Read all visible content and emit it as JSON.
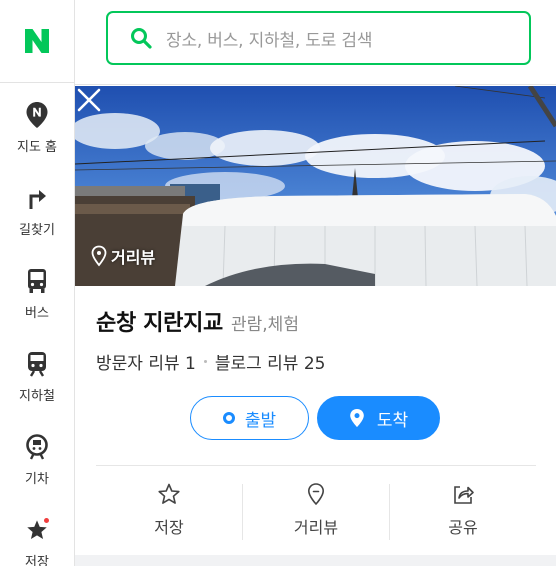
{
  "app": {
    "logo_text": "N",
    "brand_color": "#03c75a",
    "accent_color": "#1a8cff"
  },
  "search": {
    "placeholder": "장소, 버스, 지하철, 도로 검색"
  },
  "sidebar": {
    "items": [
      {
        "label": "지도 홈",
        "icon": "map-pin-n-icon"
      },
      {
        "label": "길찾기",
        "icon": "turn-right-arrow-icon"
      },
      {
        "label": "버스",
        "icon": "bus-icon"
      },
      {
        "label": "지하철",
        "icon": "subway-icon"
      },
      {
        "label": "기차",
        "icon": "train-icon"
      },
      {
        "label": "저장",
        "icon": "star-icon",
        "has_notification_dot": true
      }
    ]
  },
  "place": {
    "photo_tag": "거리뷰",
    "name": "순창 지란지교",
    "category": "관람,체험",
    "visitor_review_label": "방문자 리뷰",
    "visitor_review_count": "1",
    "blog_review_label": "블로그 리뷰",
    "blog_review_count": "25"
  },
  "buttons": {
    "depart": "출발",
    "arrive": "도착"
  },
  "actions": [
    {
      "label": "저장",
      "icon": "star-outline-icon"
    },
    {
      "label": "거리뷰",
      "icon": "streetview-pin-icon"
    },
    {
      "label": "공유",
      "icon": "share-icon"
    }
  ]
}
